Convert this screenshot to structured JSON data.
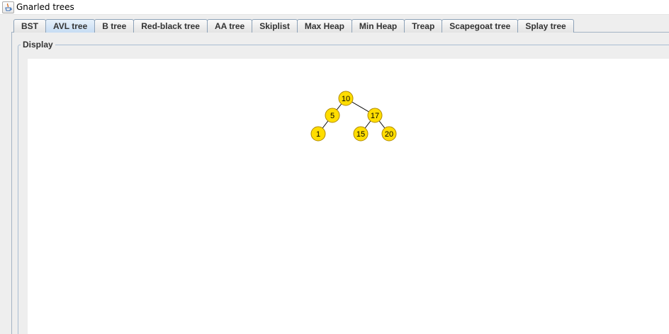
{
  "window": {
    "title": "Gnarled trees",
    "icon": "java-cup-icon"
  },
  "tabs": [
    {
      "label": "BST",
      "selected": false
    },
    {
      "label": "AVL tree",
      "selected": true
    },
    {
      "label": "B tree",
      "selected": false
    },
    {
      "label": "Red-black tree",
      "selected": false
    },
    {
      "label": "AA tree",
      "selected": false
    },
    {
      "label": "Skiplist",
      "selected": false
    },
    {
      "label": "Max Heap",
      "selected": false
    },
    {
      "label": "Min Heap",
      "selected": false
    },
    {
      "label": "Treap",
      "selected": false
    },
    {
      "label": "Scapegoat tree",
      "selected": false
    },
    {
      "label": "Splay tree",
      "selected": false
    }
  ],
  "display": {
    "legend": "Display"
  },
  "tree": {
    "node_color": "#ffdd00",
    "node_border": "#b08a00",
    "nodes": [
      {
        "id": "n10",
        "label": "10"
      },
      {
        "id": "n5",
        "label": "5"
      },
      {
        "id": "n17",
        "label": "17"
      },
      {
        "id": "n1",
        "label": "1"
      },
      {
        "id": "n15",
        "label": "15"
      },
      {
        "id": "n20",
        "label": "20"
      }
    ],
    "edges": [
      {
        "from": "n10",
        "to": "n5"
      },
      {
        "from": "n10",
        "to": "n17"
      },
      {
        "from": "n5",
        "to": "n1"
      },
      {
        "from": "n17",
        "to": "n15"
      },
      {
        "from": "n17",
        "to": "n20"
      }
    ]
  }
}
